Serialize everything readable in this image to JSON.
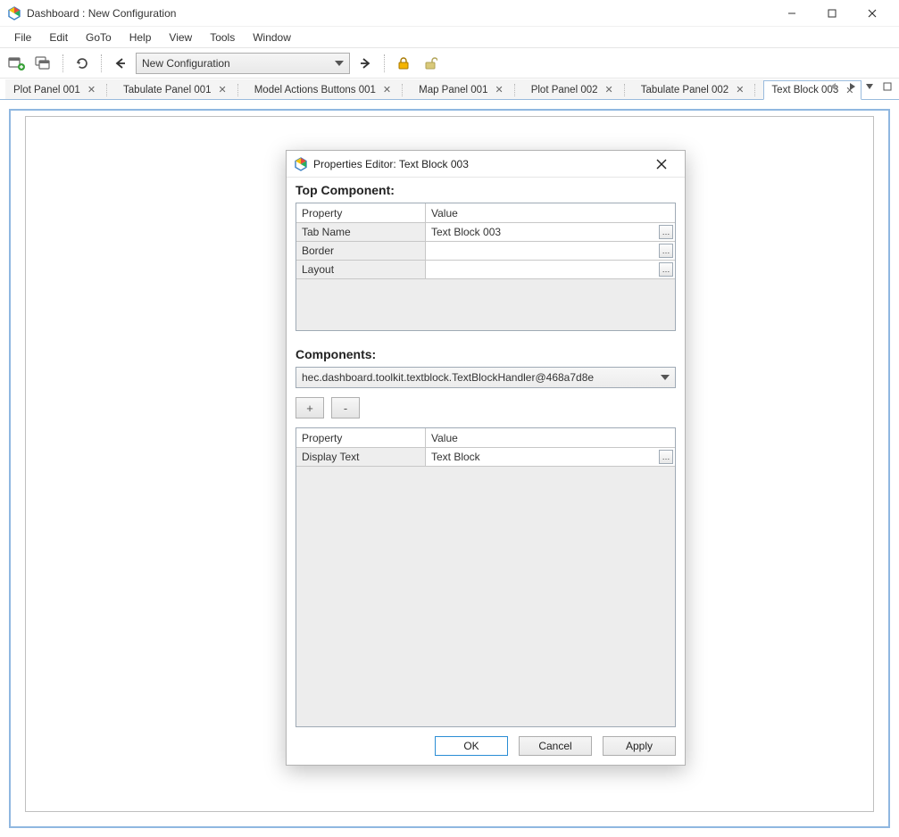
{
  "window": {
    "title": "Dashboard : New Configuration"
  },
  "menus": [
    "File",
    "Edit",
    "GoTo",
    "Help",
    "View",
    "Tools",
    "Window"
  ],
  "toolbar": {
    "config_name": "New Configuration"
  },
  "tabs": [
    {
      "label": "Plot Panel 001",
      "active": false
    },
    {
      "label": "Tabulate Panel 001",
      "active": false
    },
    {
      "label": "Model Actions Buttons 001",
      "active": false
    },
    {
      "label": "Map Panel 001",
      "active": false
    },
    {
      "label": "Plot Panel 002",
      "active": false
    },
    {
      "label": "Tabulate Panel 002",
      "active": false
    },
    {
      "label": "Text Block 003",
      "active": true
    }
  ],
  "dialog": {
    "title": "Properties Editor: Text Block 003",
    "section_top": "Top Component:",
    "section_components": "Components:",
    "headers": {
      "property": "Property",
      "value": "Value"
    },
    "top_rows": [
      {
        "key": "Tab Name",
        "value": "Text Block 003"
      },
      {
        "key": "Border",
        "value": ""
      },
      {
        "key": "Layout",
        "value": ""
      }
    ],
    "component_select": "hec.dashboard.toolkit.textblock.TextBlockHandler@468a7d8e",
    "plus": "+",
    "minus": "-",
    "lower_rows": [
      {
        "key": "Display Text",
        "value": "Text Block"
      }
    ],
    "buttons": {
      "ok": "OK",
      "cancel": "Cancel",
      "apply": "Apply"
    }
  }
}
